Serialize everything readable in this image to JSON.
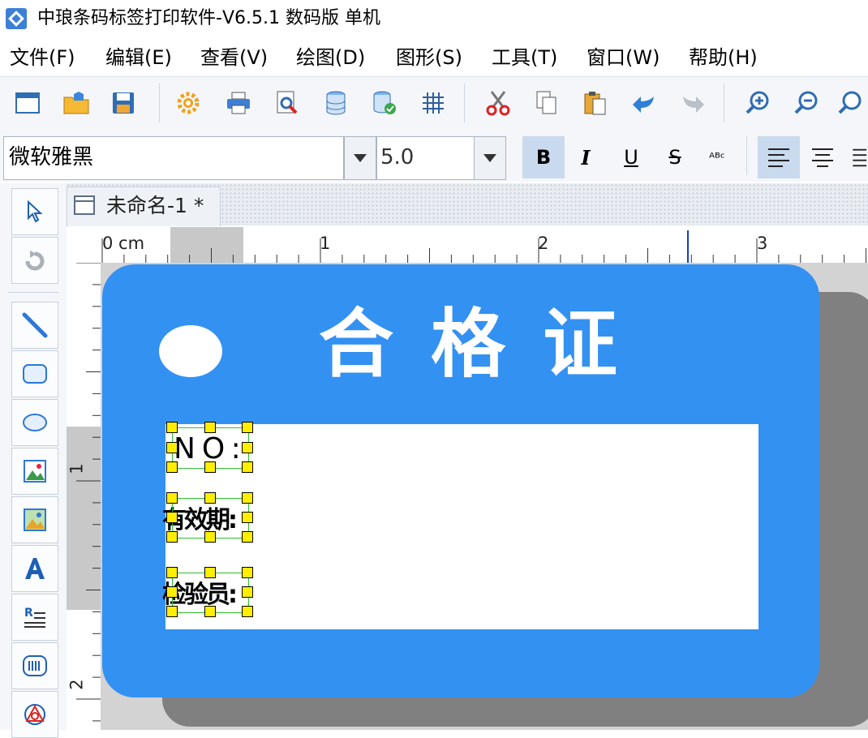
{
  "window": {
    "title": "中琅条码标签打印软件-V6.5.1 数码版 单机"
  },
  "menu": [
    {
      "label": "文件(F)"
    },
    {
      "label": "编辑(E)"
    },
    {
      "label": "查看(V)"
    },
    {
      "label": "绘图(D)"
    },
    {
      "label": "图形(S)"
    },
    {
      "label": "工具(T)"
    },
    {
      "label": "窗口(W)"
    },
    {
      "label": "帮助(H)"
    }
  ],
  "toolbar": {
    "icons": [
      "new-document-icon",
      "open-folder-icon",
      "save-icon",
      "settings-gear-icon",
      "print-icon",
      "print-preview-icon",
      "database-icon",
      "database-link-icon",
      "grid-icon",
      "cut-icon",
      "copy-icon",
      "paste-icon",
      "undo-icon",
      "redo-icon",
      "zoom-in-icon",
      "zoom-out-icon",
      "zoom-fit-icon"
    ]
  },
  "format": {
    "font_name": "微软雅黑",
    "font_size": "5.0",
    "bold": "B",
    "italic": "I",
    "underline": "U",
    "strike": "S",
    "abc": "ᴬᴮᶜ"
  },
  "document": {
    "tab_label": "未命名-1 *"
  },
  "ruler": {
    "unit_label": "0 cm",
    "h_marks": [
      "1",
      "2",
      "3"
    ],
    "v_marks": [
      "1",
      "2"
    ]
  },
  "label": {
    "title": "合格证",
    "fields": [
      {
        "text": "NO:"
      },
      {
        "text": "有效期:"
      },
      {
        "text": "检验员:"
      }
    ],
    "colors": {
      "background": "#3391f2",
      "field": "#ffffff",
      "shadow": "#808080",
      "handle": "#ffee00"
    }
  }
}
